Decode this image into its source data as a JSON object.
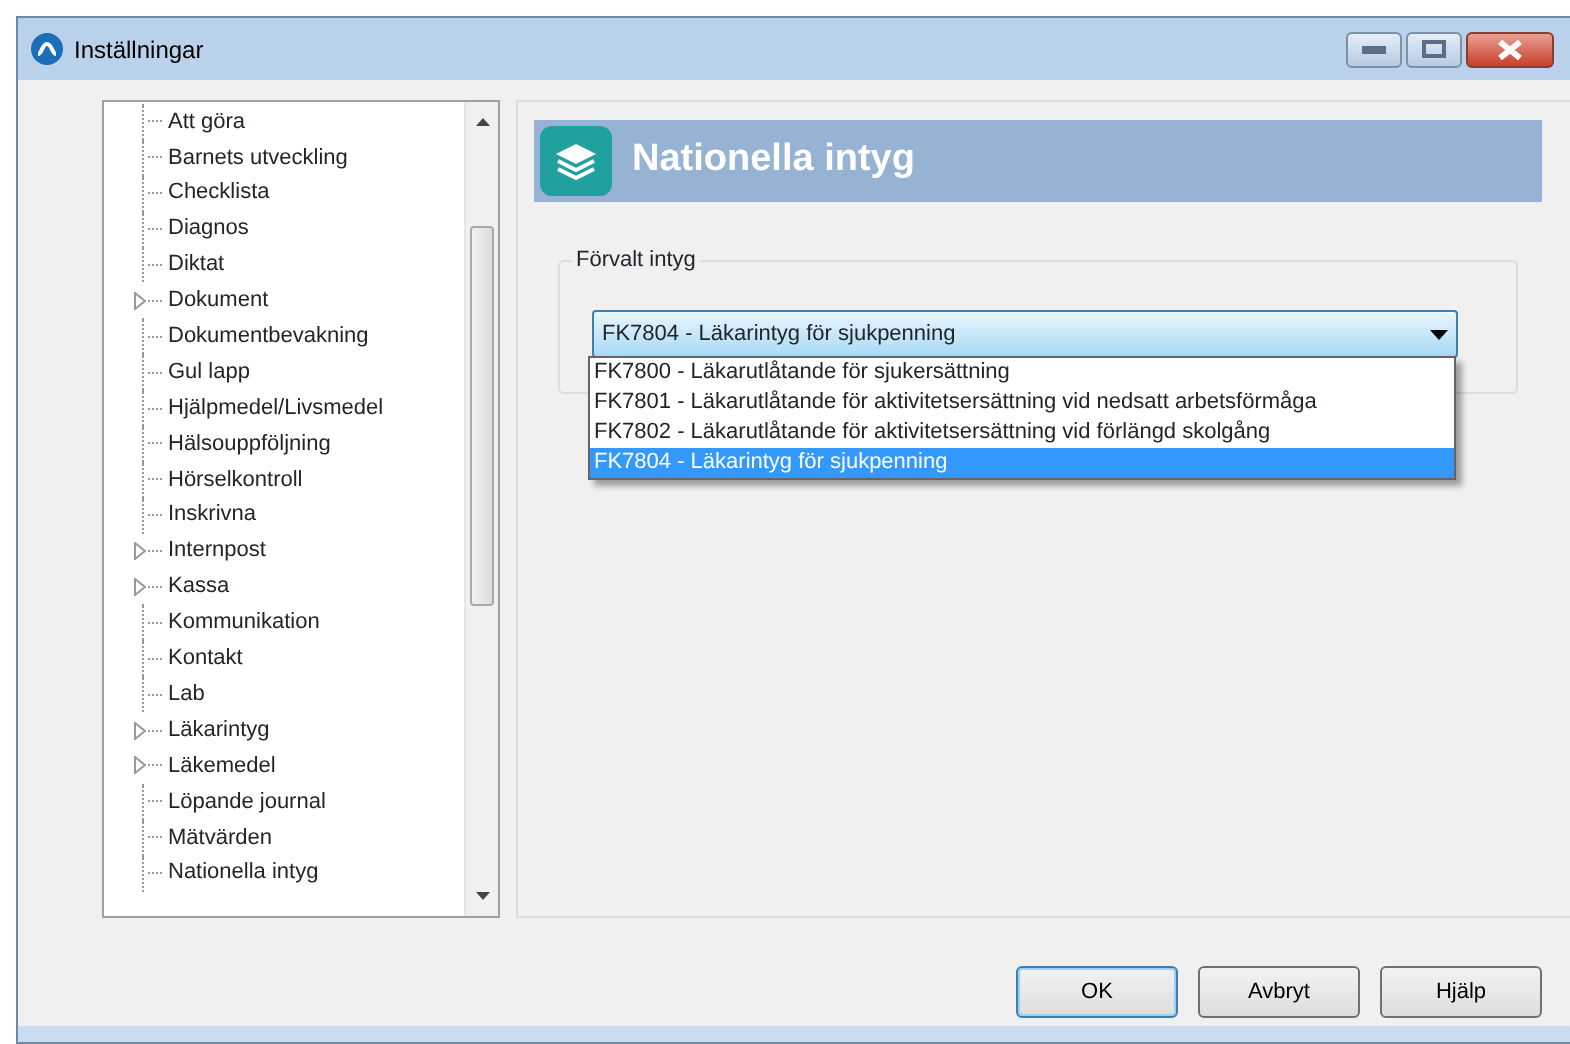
{
  "window": {
    "title": "Inställningar",
    "controls": [
      {
        "kind": "minimize"
      },
      {
        "kind": "maximize"
      },
      {
        "kind": "close"
      }
    ]
  },
  "tree": {
    "items": [
      {
        "label": "Att göra",
        "expandable": false
      },
      {
        "label": "Barnets utveckling",
        "expandable": false
      },
      {
        "label": "Checklista",
        "expandable": false
      },
      {
        "label": "Diagnos",
        "expandable": false
      },
      {
        "label": "Diktat",
        "expandable": false
      },
      {
        "label": "Dokument",
        "expandable": true
      },
      {
        "label": "Dokumentbevakning",
        "expandable": false
      },
      {
        "label": "Gul lapp",
        "expandable": false
      },
      {
        "label": "Hjälpmedel/Livsmedel",
        "expandable": false
      },
      {
        "label": "Hälsouppföljning",
        "expandable": false
      },
      {
        "label": "Hörselkontroll",
        "expandable": false
      },
      {
        "label": "Inskrivna",
        "expandable": false
      },
      {
        "label": "Internpost",
        "expandable": true
      },
      {
        "label": "Kassa",
        "expandable": true
      },
      {
        "label": "Kommunikation",
        "expandable": false
      },
      {
        "label": "Kontakt",
        "expandable": false
      },
      {
        "label": "Lab",
        "expandable": false
      },
      {
        "label": "Läkarintyg",
        "expandable": true
      },
      {
        "label": "Läkemedel",
        "expandable": true
      },
      {
        "label": "Löpande journal",
        "expandable": false
      },
      {
        "label": "Mätvärden",
        "expandable": false
      },
      {
        "label": "Nationella intyg",
        "expandable": false
      }
    ]
  },
  "panel": {
    "title": "Nationella intyg",
    "group_label": "Förvalt intyg",
    "select": {
      "value": "FK7804 - Läkarintyg för sjukpenning",
      "options": [
        {
          "label": "FK7800 - Läkarutlåtande för sjukersättning",
          "selected": false
        },
        {
          "label": "FK7801 - Läkarutlåtande för aktivitetsersättning vid nedsatt arbetsförmåga",
          "selected": false
        },
        {
          "label": "FK7802 - Läkarutlåtande för aktivitetsersättning vid förlängd skolgång",
          "selected": false
        },
        {
          "label": "FK7804 - Läkarintyg för sjukpenning",
          "selected": true
        }
      ]
    }
  },
  "buttons": [
    {
      "label": "OK",
      "default": true
    },
    {
      "label": "Avbryt",
      "default": false
    },
    {
      "label": "Hjälp",
      "default": false
    }
  ]
}
